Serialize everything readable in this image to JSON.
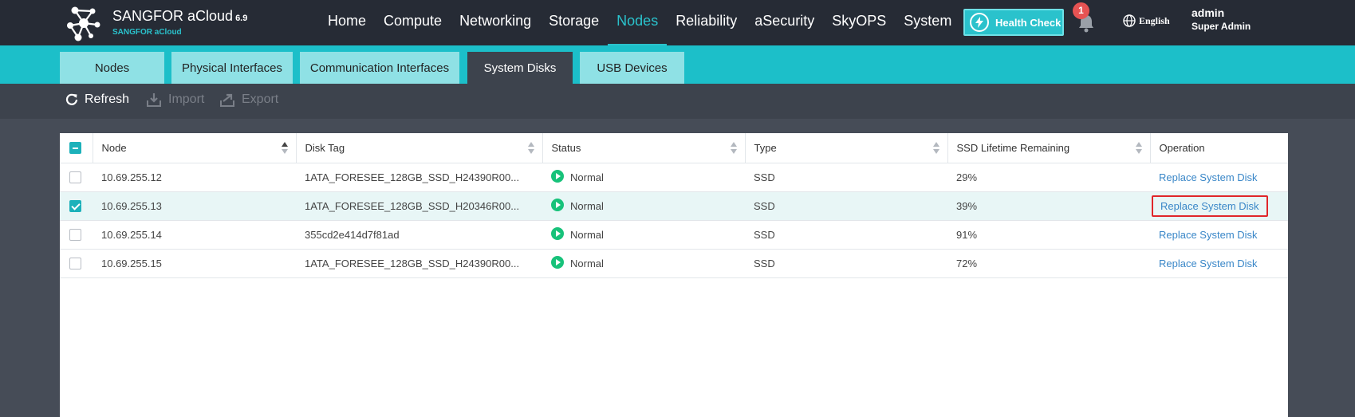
{
  "brand": {
    "title": "SANGFOR aCloud",
    "version": "6.9",
    "subtitle": "SANGFOR aCloud"
  },
  "nav": {
    "items": [
      {
        "label": "Home"
      },
      {
        "label": "Compute"
      },
      {
        "label": "Networking"
      },
      {
        "label": "Storage"
      },
      {
        "label": "Nodes"
      },
      {
        "label": "Reliability"
      },
      {
        "label": "aSecurity"
      },
      {
        "label": "SkyOPS"
      },
      {
        "label": "System"
      }
    ],
    "active": "Nodes"
  },
  "header": {
    "health_check_label": "Health Check",
    "notification_count": "1",
    "language": "English",
    "user_name": "admin",
    "user_role": "Super Admin"
  },
  "subtabs": {
    "items": [
      {
        "label": "Nodes"
      },
      {
        "label": "Physical Interfaces"
      },
      {
        "label": "Communication Interfaces"
      },
      {
        "label": "System Disks"
      },
      {
        "label": "USB Devices"
      }
    ],
    "active": "System Disks"
  },
  "toolbar": {
    "refresh_label": "Refresh",
    "import_label": "Import",
    "export_label": "Export"
  },
  "table": {
    "columns": [
      "Node",
      "Disk Tag",
      "Status",
      "Type",
      "SSD Lifetime Remaining",
      "Operation"
    ],
    "rows": [
      {
        "selected": false,
        "node": "10.69.255.12",
        "disk_tag": "1ATA_FORESEE_128GB_SSD_H24390R00...",
        "status": "Normal",
        "type": "SSD",
        "lifetime": "29%",
        "operation": "Replace System Disk"
      },
      {
        "selected": true,
        "node": "10.69.255.13",
        "disk_tag": "1ATA_FORESEE_128GB_SSD_H20346R00...",
        "status": "Normal",
        "type": "SSD",
        "lifetime": "39%",
        "operation": "Replace System Disk"
      },
      {
        "selected": false,
        "node": "10.69.255.14",
        "disk_tag": "355cd2e414d7f81ad",
        "status": "Normal",
        "type": "SSD",
        "lifetime": "91%",
        "operation": "Replace System Disk"
      },
      {
        "selected": false,
        "node": "10.69.255.15",
        "disk_tag": "1ATA_FORESEE_128GB_SSD_H24390R00...",
        "status": "Normal",
        "type": "SSD",
        "lifetime": "72%",
        "operation": "Replace System Disk"
      }
    ]
  },
  "colors": {
    "accent": "#2ac2cc",
    "topbar": "#262b35",
    "link": "#3a87c8",
    "status_normal": "#17c27a",
    "highlight": "#e0262a"
  }
}
